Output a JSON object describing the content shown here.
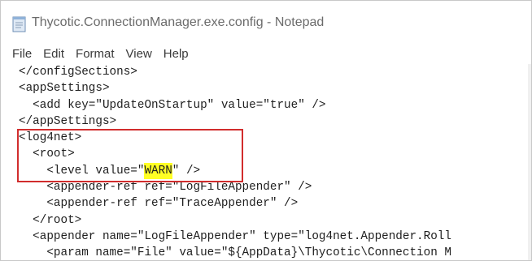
{
  "window": {
    "title": "Thycotic.ConnectionManager.exe.config - Notepad",
    "icon": "notepad-icon"
  },
  "menu": {
    "items": [
      "File",
      "Edit",
      "Format",
      "View",
      "Help"
    ]
  },
  "editor": {
    "lines": [
      {
        "indent": "",
        "text": "</configSections>"
      },
      {
        "indent": "",
        "text": "<appSettings>"
      },
      {
        "indent": "  ",
        "text": "<add key=\"UpdateOnStartup\" value=\"true\" />"
      },
      {
        "indent": "",
        "text": "</appSettings>"
      },
      {
        "indent": "",
        "text": "<log4net>"
      },
      {
        "indent": "  ",
        "text": "<root>"
      },
      {
        "indent": "    ",
        "before": "<level value=\"",
        "highlight": "WARN",
        "after": "\" />"
      },
      {
        "indent": "    ",
        "text": "<appender-ref ref=\"LogFileAppender\" />"
      },
      {
        "indent": "    ",
        "text": "<appender-ref ref=\"TraceAppender\" />"
      },
      {
        "indent": "  ",
        "text": "</root>"
      },
      {
        "indent": "  ",
        "text": "<appender name=\"LogFileAppender\" type=\"log4net.Appender.Roll"
      },
      {
        "indent": "    ",
        "text": "<param name=\"File\" value=\"${AppData}\\Thycotic\\Connection M"
      }
    ],
    "highlight_color": "#ffff24",
    "annotation_color": "#d12d2d"
  }
}
